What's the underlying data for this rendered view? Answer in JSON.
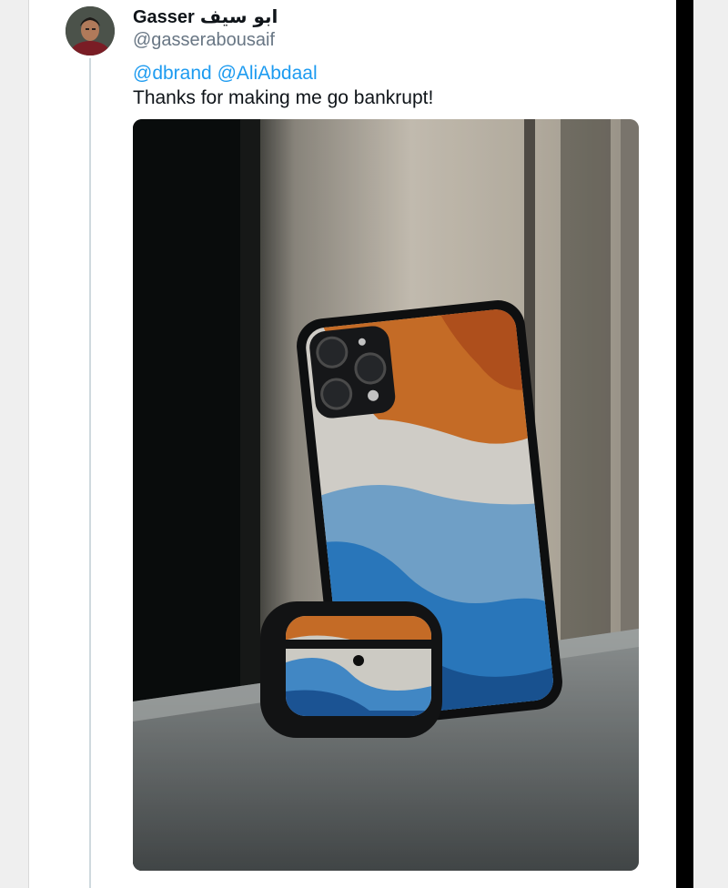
{
  "tweet": {
    "author_name": "Gasser",
    "author_name_arabic": "ابو سيف",
    "handle": "@gasserabousaif",
    "mentions": [
      "@dbrand",
      "@AliAbdaal"
    ],
    "text": "Thanks for making me go bankrupt!",
    "avatar_icon": "profile-photo",
    "media_icon": "photo-of-phone-and-earbuds-case"
  },
  "colors": {
    "link": "#1d9bf0",
    "text": "#0f1419",
    "secondary": "#687684",
    "thread_line": "#cfd9de"
  }
}
